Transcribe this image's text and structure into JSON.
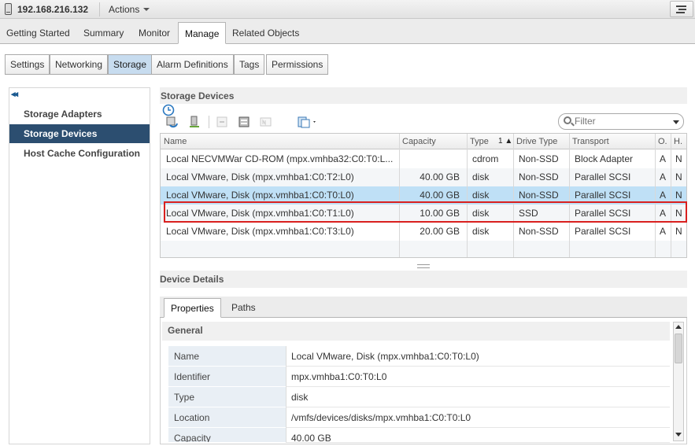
{
  "header": {
    "host": "192.168.216.132",
    "actions_label": "Actions"
  },
  "tabs": [
    "Getting Started",
    "Summary",
    "Monitor",
    "Manage",
    "Related Objects"
  ],
  "active_tab": "Manage",
  "subtabs": [
    "Settings",
    "Networking",
    "Storage",
    "Alarm Definitions",
    "Tags",
    "Permissions"
  ],
  "active_subtab": "Storage",
  "nav": {
    "collapse_glyph": "◂◂",
    "items": [
      "Storage Adapters",
      "Storage Devices",
      "Host Cache Configuration"
    ],
    "active": "Storage Devices"
  },
  "storage_devices": {
    "title": "Storage Devices",
    "filter_placeholder": "Filter",
    "columns": [
      "Name",
      "Capacity",
      "Type",
      "Drive Type",
      "Transport",
      "O.",
      "H."
    ],
    "sort_indicator": "1 ▲",
    "rows": [
      {
        "name": "Local NECVMWar CD-ROM (mpx.vmhba32:C0:T0:L...",
        "capacity": "",
        "type": "cdrom",
        "drive_type": "Non-SSD",
        "transport": "Block Adapter",
        "o": "A",
        "h": "N"
      },
      {
        "name": "Local VMware, Disk (mpx.vmhba1:C0:T2:L0)",
        "capacity": "40.00 GB",
        "type": "disk",
        "drive_type": "Non-SSD",
        "transport": "Parallel SCSI",
        "o": "A",
        "h": "N"
      },
      {
        "name": "Local VMware, Disk (mpx.vmhba1:C0:T0:L0)",
        "capacity": "40.00 GB",
        "type": "disk",
        "drive_type": "Non-SSD",
        "transport": "Parallel SCSI",
        "o": "A",
        "h": "N"
      },
      {
        "name": "Local VMware, Disk (mpx.vmhba1:C0:T1:L0)",
        "capacity": "10.00 GB",
        "type": "disk",
        "drive_type": "SSD",
        "transport": "Parallel SCSI",
        "o": "A",
        "h": "N"
      },
      {
        "name": "Local VMware, Disk (mpx.vmhba1:C0:T3:L0)",
        "capacity": "20.00 GB",
        "type": "disk",
        "drive_type": "Non-SSD",
        "transport": "Parallel SCSI",
        "o": "A",
        "h": "N"
      }
    ],
    "selected_row": 2,
    "highlighted_row": 3
  },
  "details": {
    "title": "Device Details",
    "tabs": [
      "Properties",
      "Paths"
    ],
    "active_tab": "Properties",
    "section_title": "General",
    "properties": [
      {
        "label": "Name",
        "value": "Local VMware, Disk (mpx.vmhba1:C0:T0:L0)"
      },
      {
        "label": "Identifier",
        "value": "mpx.vmhba1:C0:T0:L0"
      },
      {
        "label": "Type",
        "value": "disk"
      },
      {
        "label": "Location",
        "value": "/vmfs/devices/disks/mpx.vmhba1:C0:T0:L0"
      },
      {
        "label": "Capacity",
        "value": "40.00 GB"
      }
    ]
  },
  "colors": {
    "nav_active": "#2c4e70",
    "row_selected": "#bfe0f6",
    "subtab_active": "#c7dcef",
    "highlight_border": "#d9201f"
  }
}
